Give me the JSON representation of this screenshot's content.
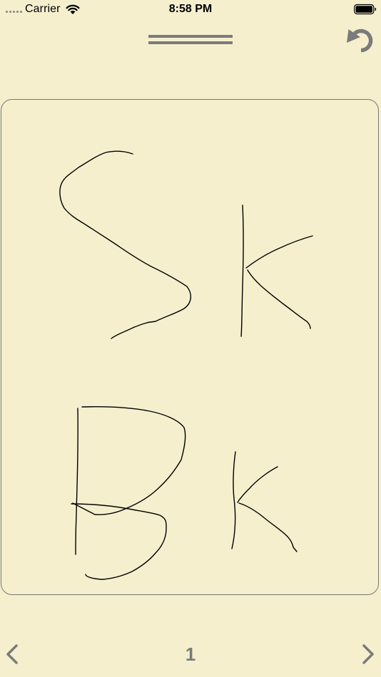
{
  "status_bar": {
    "carrier": "Carrier",
    "time": "8:58 PM"
  },
  "icons": {
    "signal": "signal-dots-icon",
    "wifi": "wifi-icon",
    "battery": "battery-icon",
    "drag_handle": "drag-handle-icon",
    "undo": "undo-icon",
    "prev": "chevron-left-icon",
    "next": "chevron-right-icon"
  },
  "colors": {
    "background": "#f5efce",
    "icon_gray": "#7b7b7b",
    "ink": "#000000"
  },
  "pager": {
    "page_number": "1"
  }
}
